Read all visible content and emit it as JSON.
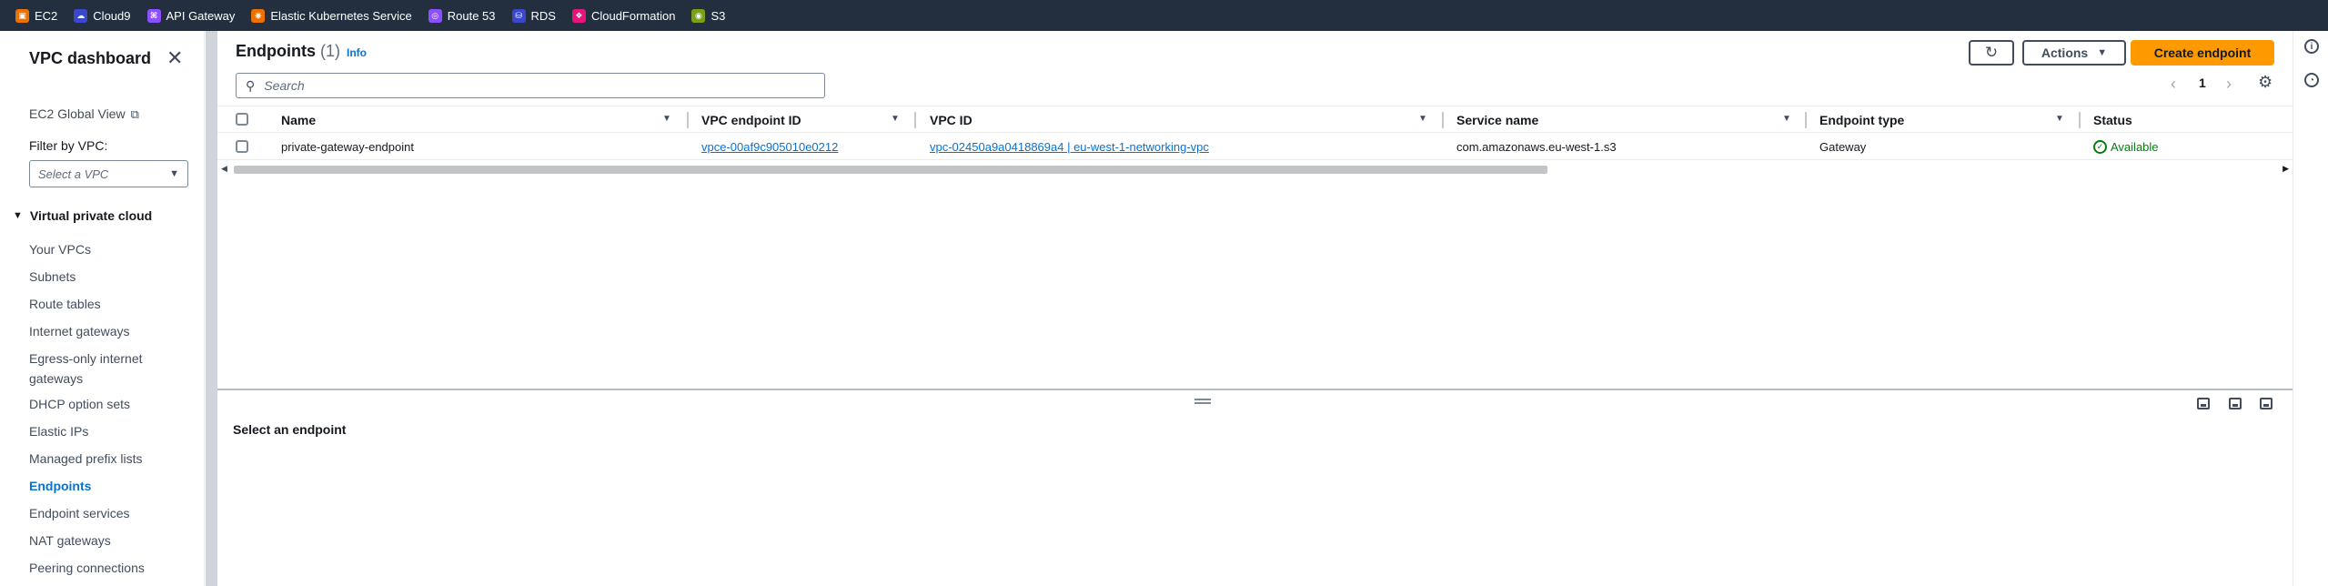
{
  "favorites": [
    {
      "label": "EC2",
      "icon": "ec2-icon",
      "color": "#ed7100",
      "glyph": "▣"
    },
    {
      "label": "Cloud9",
      "icon": "cloud9-icon",
      "color": "#3b48cc",
      "glyph": "☁"
    },
    {
      "label": "API Gateway",
      "icon": "api-gateway-icon",
      "color": "#8c4fff",
      "glyph": "⌘"
    },
    {
      "label": "Elastic Kubernetes Service",
      "icon": "eks-icon",
      "color": "#ed7100",
      "glyph": "⎈"
    },
    {
      "label": "Route 53",
      "icon": "route53-icon",
      "color": "#8c4fff",
      "glyph": "◎"
    },
    {
      "label": "RDS",
      "icon": "rds-icon",
      "color": "#3b48cc",
      "glyph": "⛁"
    },
    {
      "label": "CloudFormation",
      "icon": "cloudformation-icon",
      "color": "#e7157b",
      "glyph": "❖"
    },
    {
      "label": "S3",
      "icon": "s3-icon",
      "color": "#7aa116",
      "glyph": "◉"
    }
  ],
  "sidebar": {
    "title": "VPC dashboard",
    "global_view": "EC2 Global View",
    "filter_label": "Filter by VPC:",
    "filter_placeholder": "Select a VPC",
    "section": "Virtual private cloud",
    "items": [
      {
        "label": "Your VPCs",
        "active": false
      },
      {
        "label": "Subnets",
        "active": false
      },
      {
        "label": "Route tables",
        "active": false
      },
      {
        "label": "Internet gateways",
        "active": false
      },
      {
        "label": "Egress-only internet gateways",
        "active": false
      },
      {
        "label": "DHCP option sets",
        "active": false
      },
      {
        "label": "Elastic IPs",
        "active": false
      },
      {
        "label": "Managed prefix lists",
        "active": false
      },
      {
        "label": "Endpoints",
        "active": true
      },
      {
        "label": "Endpoint services",
        "active": false
      },
      {
        "label": "NAT gateways",
        "active": false
      },
      {
        "label": "Peering connections",
        "active": false
      }
    ]
  },
  "main": {
    "title": "Endpoints",
    "count": "(1)",
    "info": "Info",
    "actions_label": "Actions",
    "create_label": "Create endpoint",
    "search_placeholder": "Search",
    "page_number": "1",
    "columns": [
      "Name",
      "VPC endpoint ID",
      "VPC ID",
      "Service name",
      "Endpoint type",
      "Status"
    ],
    "rows": [
      {
        "name": "private-gateway-endpoint",
        "endpoint_id": "vpce-00af9c905010e0212",
        "vpc_id": "vpc-02450a9a0418869a4 | eu-west-1-networking-vpc",
        "service_name": "com.amazonaws.eu-west-1.s3",
        "endpoint_type": "Gateway",
        "status": "Available"
      }
    ],
    "detail_message": "Select an endpoint"
  },
  "colors": {
    "topbar": "#232f3e",
    "primary_button": "#ff9900",
    "link": "#0972d3",
    "success": "#037f0c"
  }
}
